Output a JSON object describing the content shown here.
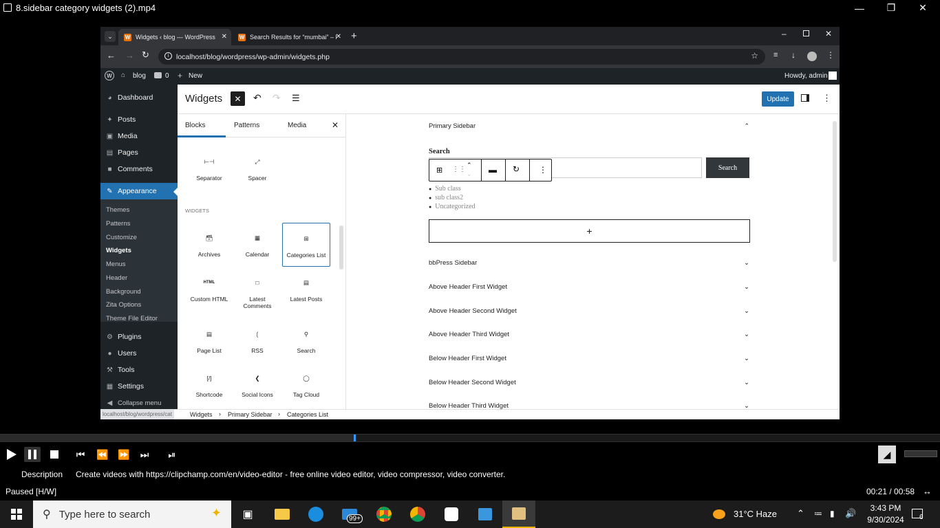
{
  "player": {
    "title": "8.sidebar category widgets (2).mp4",
    "description_label": "Description",
    "description_text": "Create videos with https://clipchamp.com/en/video-editor - free online video editor, video compressor, video converter.",
    "status": "Paused [H/W]",
    "time": "00:21 / 00:58",
    "progress": 0.376
  },
  "browser": {
    "tabs": [
      {
        "label": "Widgets ‹ blog — WordPress",
        "active": true
      },
      {
        "label": "Search Results for “mumbai” – l",
        "active": false
      }
    ],
    "url": "localhost/blog/wordpress/wp-admin/widgets.php"
  },
  "adminbar": {
    "site": "blog",
    "comments": "0",
    "new": "New",
    "howdy": "Howdy, admin"
  },
  "wpmenu": {
    "items": [
      {
        "label": "Dashboard",
        "icon": "dashboard-icon"
      },
      {
        "label": "Posts",
        "icon": "pin-icon"
      },
      {
        "label": "Media",
        "icon": "media-icon"
      },
      {
        "label": "Pages",
        "icon": "pages-icon"
      },
      {
        "label": "Comments",
        "icon": "comment-icon"
      },
      {
        "label": "Appearance",
        "icon": "brush-icon"
      }
    ],
    "appearance_sub": [
      "Themes",
      "Patterns",
      "Customize",
      "Widgets",
      "Menus",
      "Header",
      "Background",
      "Zita Options",
      "Theme File Editor"
    ],
    "items2": [
      {
        "label": "Plugins",
        "icon": "plugin-icon"
      },
      {
        "label": "Users",
        "icon": "user-icon"
      },
      {
        "label": "Tools",
        "icon": "wrench-icon"
      },
      {
        "label": "Settings",
        "icon": "settings-icon"
      }
    ],
    "collapse": "Collapse menu"
  },
  "editor": {
    "title": "Widgets",
    "update": "Update",
    "inserter_tabs": [
      "Blocks",
      "Patterns",
      "Media"
    ],
    "section_label": "WIDGETS",
    "top_blocks": [
      "Separator",
      "Spacer"
    ],
    "widget_blocks": [
      "Archives",
      "Calendar",
      "Categories List",
      "Custom HTML",
      "Latest Comments",
      "Latest Posts",
      "Page List",
      "RSS",
      "Search",
      "Shortcode",
      "Social Icons",
      "Tag Cloud"
    ],
    "html_icon_text": "HTML",
    "primary_sidebar": "Primary Sidebar",
    "search_label": "Search",
    "search_button": "Search",
    "categories": [
      "Sub class",
      "sub class2",
      "Uncategorized"
    ],
    "areas": [
      "bbPress Sidebar",
      "Above Header First Widget",
      "Above Header Second Widget",
      "Above Header Third Widget",
      "Below Header First Widget",
      "Below Header Second Widget",
      "Below Header Third Widget"
    ],
    "status_url": "localhost/blog/wordpress/cat",
    "breadcrumb": [
      "Widgets",
      "Primary Sidebar",
      "Categories List"
    ]
  },
  "taskbar": {
    "search_placeholder": "Type here to search",
    "weather": "31°C  Haze",
    "time": "3:43 PM",
    "date": "9/30/2024",
    "mail_badge": "99+",
    "notifications": "6"
  }
}
